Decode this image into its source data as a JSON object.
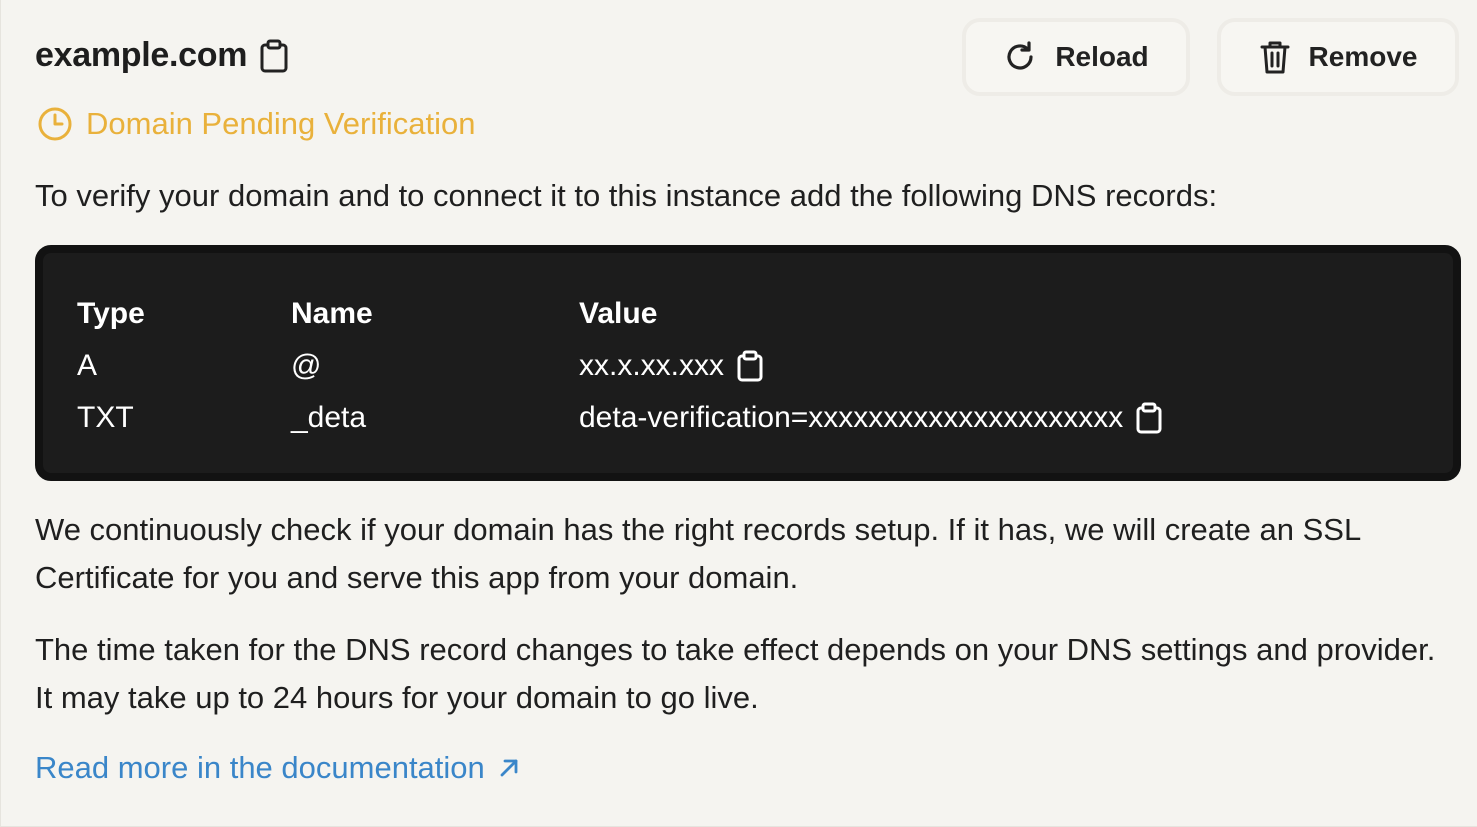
{
  "domain": {
    "name": "example.com",
    "copy_icon": "clipboard-icon"
  },
  "actions": {
    "reload_label": "Reload",
    "reload_icon": "refresh-icon",
    "remove_label": "Remove",
    "remove_icon": "trash-icon"
  },
  "status": {
    "text": "Domain Pending Verification",
    "icon": "clock-icon",
    "color": "#e9b13b"
  },
  "intro": "To verify your domain and to connect it to this instance add the following DNS records:",
  "dns_table": {
    "headers": [
      "Type",
      "Name",
      "Value"
    ],
    "rows": [
      {
        "type": "A",
        "name": "@",
        "value": "xx.x.xx.xxx"
      },
      {
        "type": "TXT",
        "name": "_deta",
        "value": "deta-verification=xxxxxxxxxxxxxxxxxxxxx"
      }
    ]
  },
  "info_paragraphs": [
    "We continuously check if your domain has the right records setup. If it has, we will create an SSL Certificate for you and serve this app from your domain.",
    "The time taken for the DNS record changes to take effect depends on your DNS settings and provider. It may take up to 24 hours for your domain to go live."
  ],
  "docs_link": {
    "label": "Read more in the documentation",
    "icon": "external-arrow-icon",
    "color": "#3a86c9"
  },
  "colors": {
    "background": "#f5f4f0",
    "dns_box": "#1c1c1c"
  }
}
